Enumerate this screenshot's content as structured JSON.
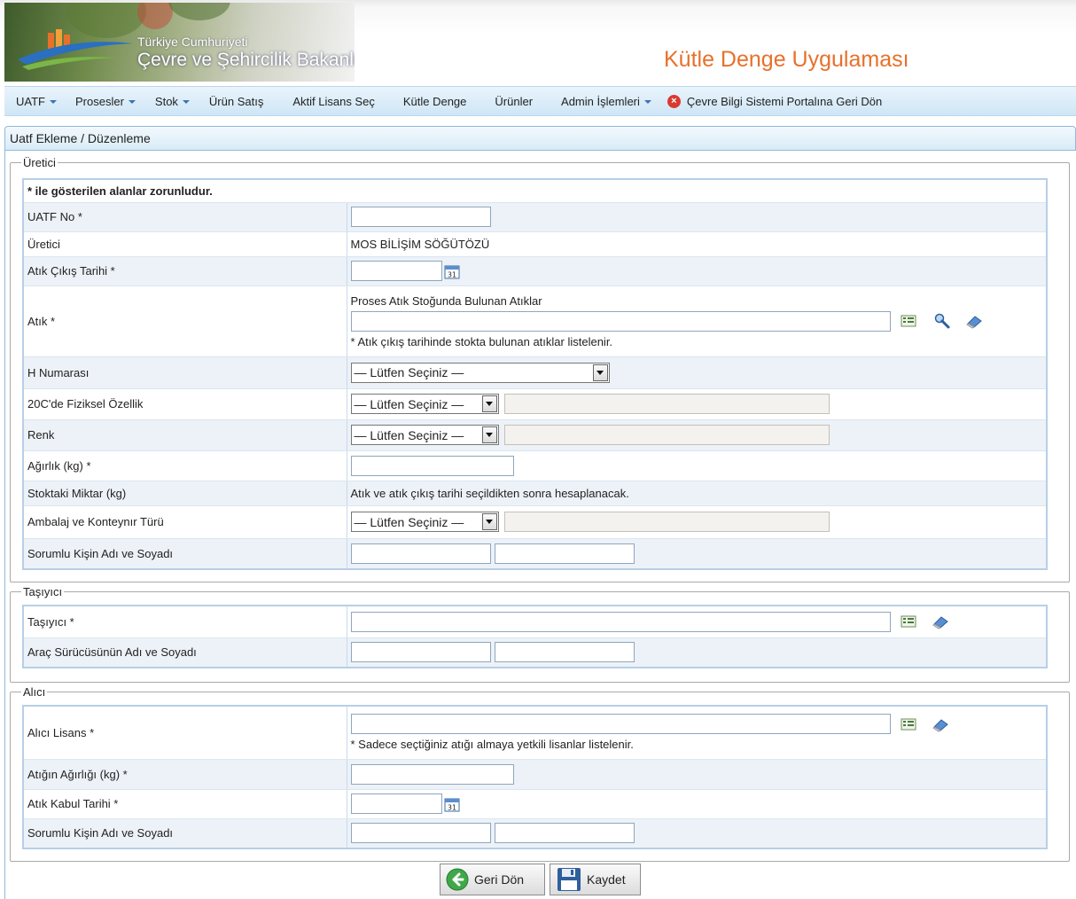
{
  "header": {
    "ministry_top": "Türkiye Cumhuriyeti",
    "ministry_name": "Çevre ve Şehircilik Bakanlığı",
    "app_title": "Kütle Denge Uygulaması"
  },
  "menu": {
    "items": [
      {
        "label": "UATF",
        "dropdown": true
      },
      {
        "label": "Prosesler",
        "dropdown": true
      },
      {
        "label": "Stok",
        "dropdown": true
      },
      {
        "label": "Ürün Satış",
        "dropdown": false
      },
      {
        "label": "Aktif Lisans Seç",
        "dropdown": false
      },
      {
        "label": "Kütle Denge",
        "dropdown": false
      },
      {
        "label": "Ürünler",
        "dropdown": false
      },
      {
        "label": "Admin İşlemleri",
        "dropdown": true
      }
    ],
    "portal_return": "Çevre Bilgi Sistemi Portalına Geri Dön"
  },
  "panel": {
    "title": "Uatf Ekleme / Düzenleme"
  },
  "uretici": {
    "legend": "Üretici",
    "required_note": "* ile gösterilen alanlar zorunludur.",
    "uatf_no_label": "UATF No *",
    "uretici_label": "Üretici",
    "uretici_value": "MOS BİLİŞİM SÖĞÜTÖZÜ",
    "cikis_tarihi_label": "Atık Çıkış Tarihi *",
    "atik_label": "Atık *",
    "atik_title": "Proses Atık Stoğunda Bulunan Atıklar",
    "atik_note": "* Atık çıkış tarihinde stokta bulunan atıklar listelenir.",
    "h_numarasi_label": "H Numarası",
    "fiziksel_label": "20C'de Fiziksel Özellik",
    "renk_label": "Renk",
    "agirlik_label": "Ağırlık (kg) *",
    "stok_miktar_label": "Stoktaki Miktar (kg)",
    "stok_miktar_value": "Atık ve atık çıkış tarihi seçildikten sonra hesaplanacak.",
    "ambalaj_label": "Ambalaj ve Konteynır Türü",
    "sorumlu_label": "Sorumlu Kişin Adı ve Soyadı",
    "select_placeholder": "— Lütfen Seçiniz —"
  },
  "tasiyici": {
    "legend": "Taşıyıcı",
    "tasiyici_label": "Taşıyıcı *",
    "surucu_label": "Araç Sürücüsünün Adı ve Soyadı"
  },
  "alici": {
    "legend": "Alıcı",
    "lisans_label": "Alıcı Lisans *",
    "lisans_note": "* Sadece seçtiğiniz atığı almaya yetkili lisanlar listelenir.",
    "agirlik_label": "Atığın Ağırlığı (kg) *",
    "kabul_tarihi_label": "Atık Kabul Tarihi *",
    "sorumlu_label": "Sorumlu Kişin Adı ve Soyadı"
  },
  "buttons": {
    "back": "Geri Dön",
    "save": "Kaydet"
  },
  "colors": {
    "accent": "#e8702a",
    "menu_bg": "#cfe6f6",
    "border_blue": "#8fb9dc"
  }
}
